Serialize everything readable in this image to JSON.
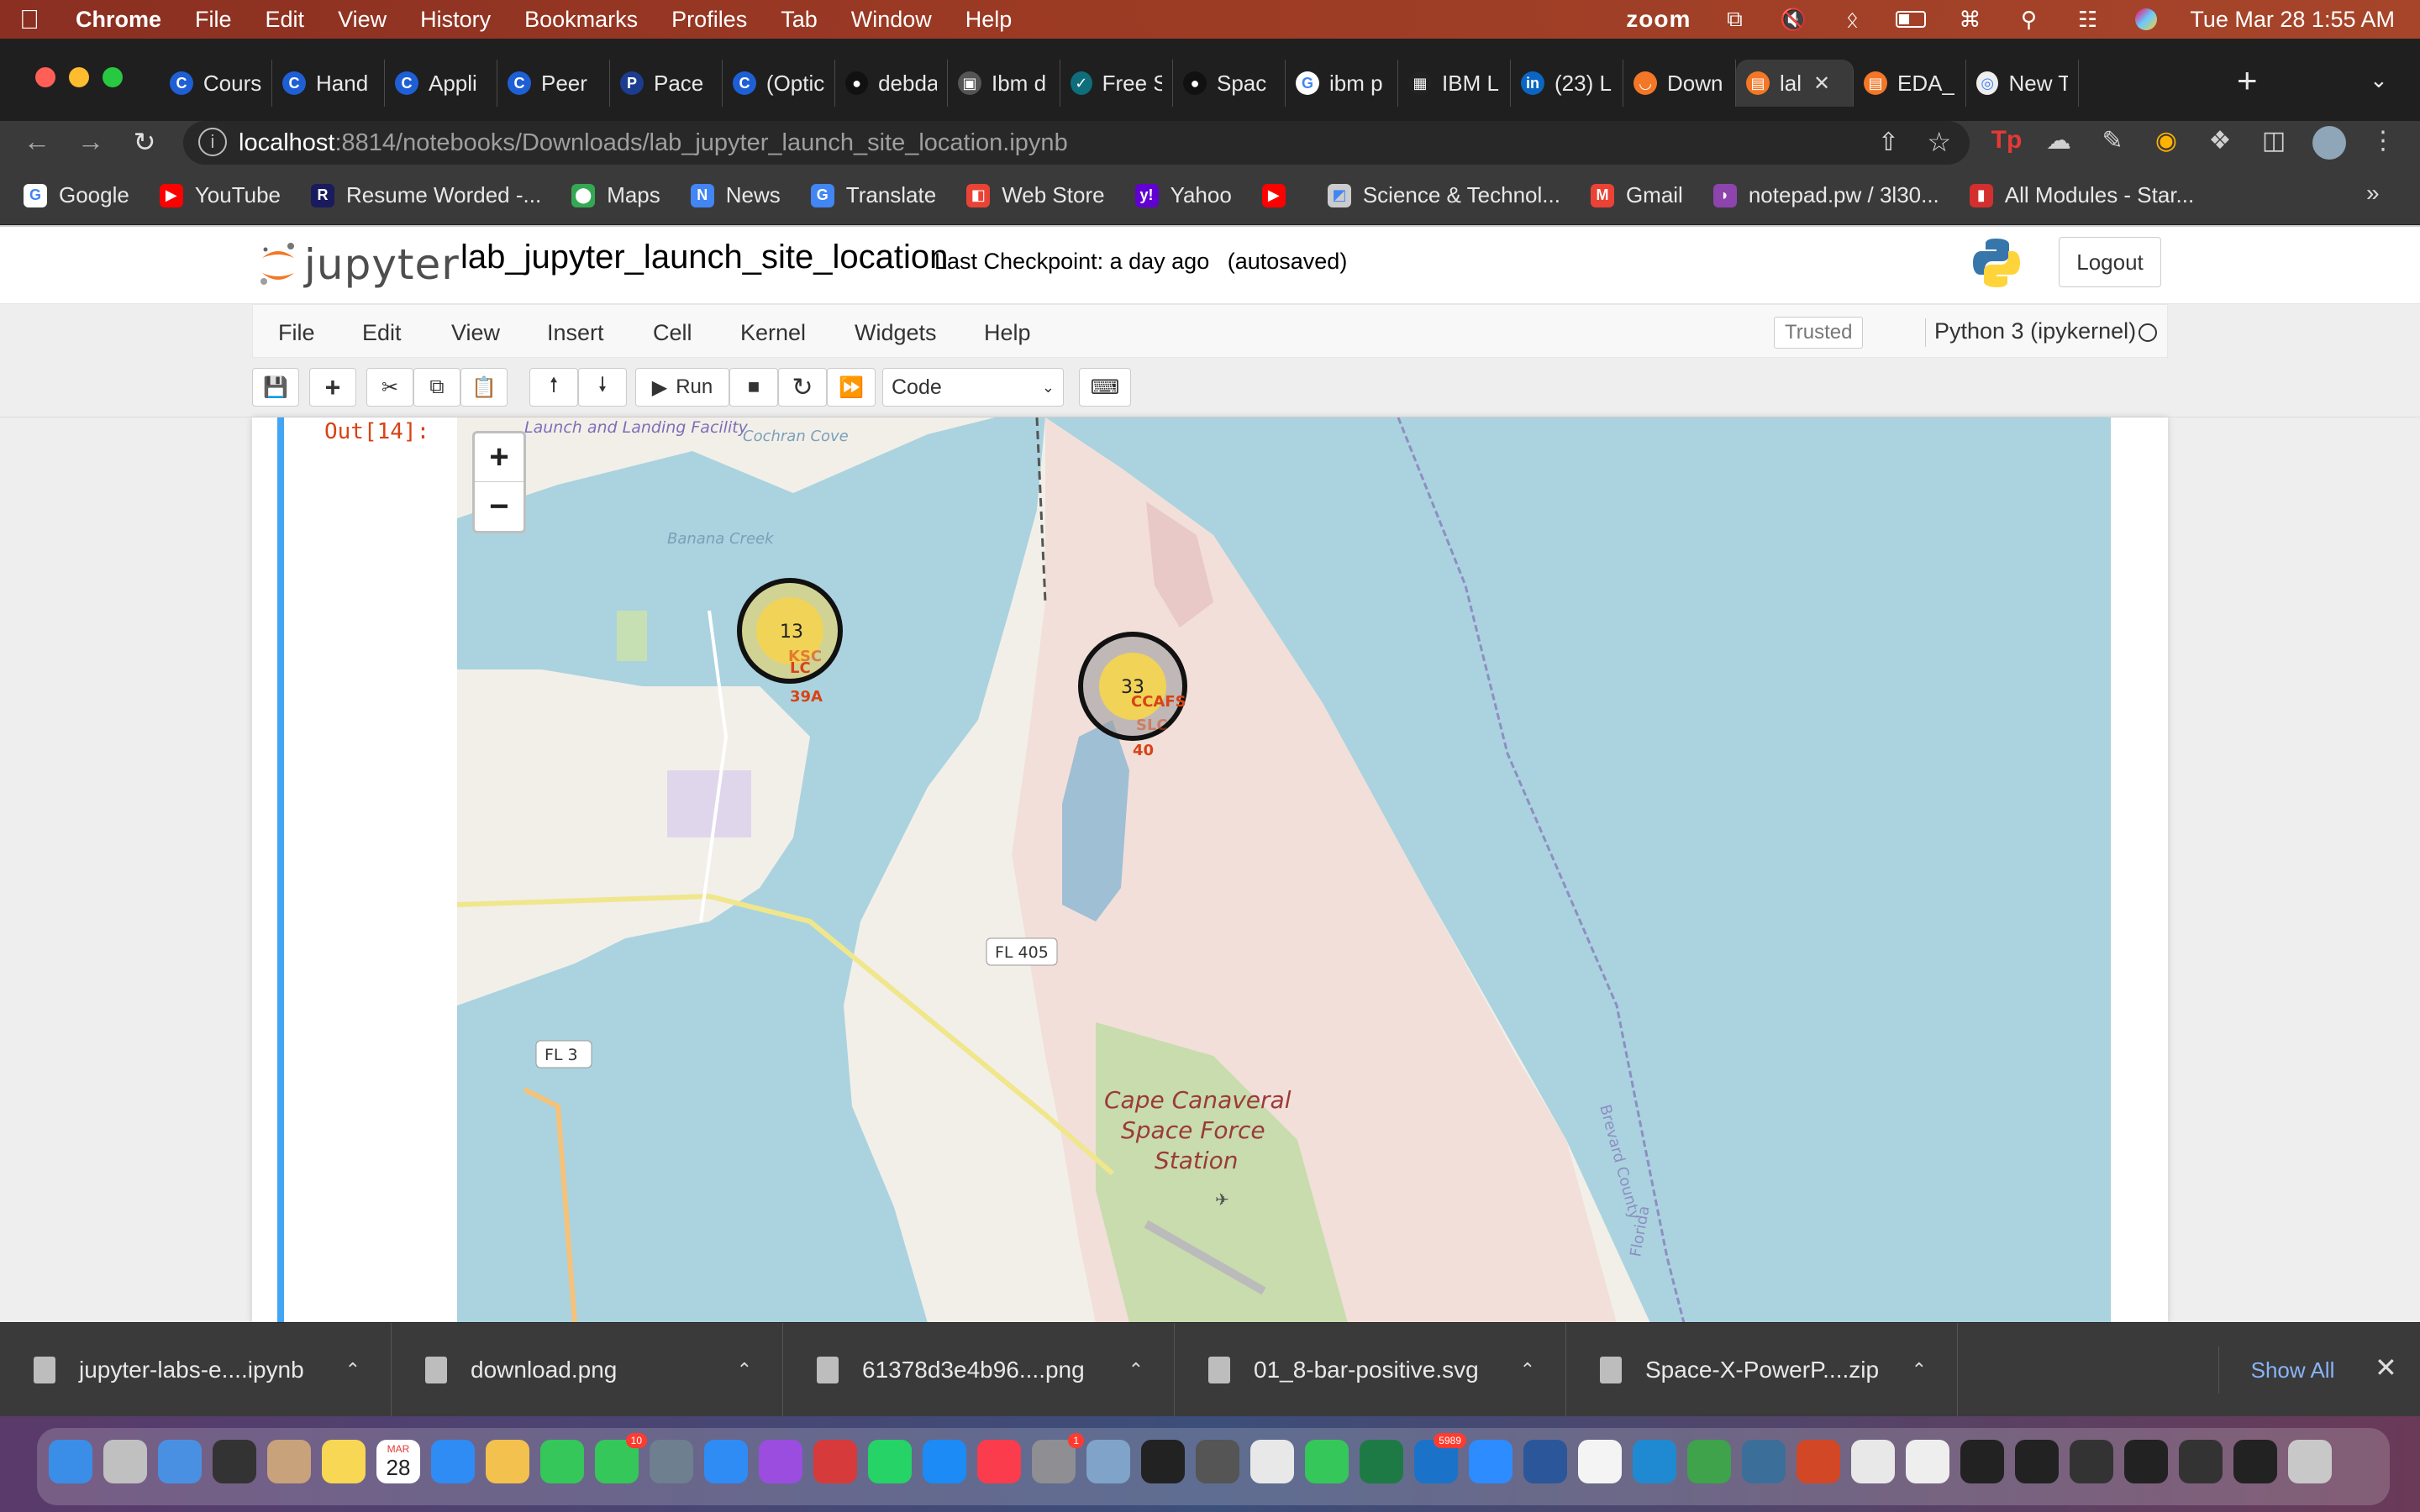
{
  "menubar": {
    "app": "Chrome",
    "items": [
      "File",
      "Edit",
      "View",
      "History",
      "Bookmarks",
      "Profiles",
      "Tab",
      "Window",
      "Help"
    ],
    "zoom_label": "zoom",
    "datetime": "Tue Mar 28  1:55 AM"
  },
  "tabs": [
    {
      "label": "Cours",
      "icon": "coursera-icon",
      "color": "#1f5fd6",
      "glyph": "C"
    },
    {
      "label": "Hand",
      "icon": "coursera-icon",
      "color": "#1f5fd6",
      "glyph": "C"
    },
    {
      "label": "Appli",
      "icon": "coursera-icon",
      "color": "#1f5fd6",
      "glyph": "C"
    },
    {
      "label": "Peer",
      "icon": "coursera-icon",
      "color": "#1f5fd6",
      "glyph": "C"
    },
    {
      "label": "Pace",
      "icon": "pace-icon",
      "color": "#1c3d8f",
      "glyph": "P"
    },
    {
      "label": "(Optic",
      "icon": "coursera-icon",
      "color": "#1f5fd6",
      "glyph": "C"
    },
    {
      "label": "debda",
      "icon": "github-icon",
      "color": "#111111",
      "glyph": "●"
    },
    {
      "label": "Ibm d",
      "icon": "ibm-icon",
      "color": "#555555",
      "glyph": "▣"
    },
    {
      "label": "Free S",
      "icon": "freecodecamp-icon",
      "color": "#0f6e7c",
      "glyph": "✓"
    },
    {
      "label": "Spac",
      "icon": "github-icon",
      "color": "#111111",
      "glyph": "●"
    },
    {
      "label": "ibm p",
      "icon": "google-icon",
      "color": "#ffffff",
      "glyph": "G"
    },
    {
      "label": "IBM L",
      "icon": "ibm-logo-icon",
      "color": "#222222",
      "glyph": "▦"
    },
    {
      "label": "(23) L",
      "icon": "linkedin-icon",
      "color": "#0a66c2",
      "glyph": "in"
    },
    {
      "label": "Down",
      "icon": "jupyter-icon",
      "color": "#f37726",
      "glyph": "◡"
    },
    {
      "label": "lal",
      "icon": "notebook-icon",
      "color": "#f37726",
      "glyph": "▤",
      "active": true
    },
    {
      "label": "EDA_",
      "icon": "notebook-icon",
      "color": "#f37726",
      "glyph": "▤"
    },
    {
      "label": "New T",
      "icon": "chrome-icon",
      "color": "#eeeeee",
      "glyph": "◎"
    }
  ],
  "address": {
    "host": "localhost",
    "path": ":8814/notebooks/Downloads/lab_jupyter_launch_site_location.ipynb"
  },
  "bookmarks": [
    {
      "label": "Google",
      "icon": "google-icon",
      "color": "#ffffff",
      "glyph": "G"
    },
    {
      "label": "YouTube",
      "icon": "youtube-icon",
      "color": "#ff0000",
      "glyph": "▶"
    },
    {
      "label": "Resume Worded -...",
      "icon": "resume-worded-icon",
      "color": "#1a1a5e",
      "glyph": "R"
    },
    {
      "label": "Maps",
      "icon": "maps-icon",
      "color": "#34a853",
      "glyph": "⬤"
    },
    {
      "label": "News",
      "icon": "news-icon",
      "color": "#4285f4",
      "glyph": "N"
    },
    {
      "label": "Translate",
      "icon": "translate-icon",
      "color": "#4285f4",
      "glyph": "G"
    },
    {
      "label": "Web Store",
      "icon": "webstore-icon",
      "color": "#ea4335",
      "glyph": "◧"
    },
    {
      "label": "Yahoo",
      "icon": "yahoo-icon",
      "color": "#6001d2",
      "glyph": "y!"
    },
    {
      "label": "",
      "icon": "youtube-icon",
      "color": "#ff0000",
      "glyph": "▶"
    },
    {
      "label": "Science & Technol...",
      "icon": "science-icon",
      "color": "#cccccc",
      "glyph": "◩"
    },
    {
      "label": "Gmail",
      "icon": "gmail-icon",
      "color": "#ea4335",
      "glyph": "M"
    },
    {
      "label": "notepad.pw / 3l30...",
      "icon": "notepad-icon",
      "color": "#8e44ad",
      "glyph": "◗"
    },
    {
      "label": "All Modules - Star...",
      "icon": "modules-icon",
      "color": "#d32f2f",
      "glyph": "▮"
    }
  ],
  "jupyter": {
    "logo_text": "jupyter",
    "notebook_title": "lab_jupyter_launch_site_location",
    "checkpoint": "Last Checkpoint: a day ago",
    "autosave": "(autosaved)",
    "logout": "Logout",
    "menu": [
      "File",
      "Edit",
      "View",
      "Insert",
      "Cell",
      "Kernel",
      "Widgets",
      "Help"
    ],
    "trusted": "Trusted",
    "kernel": "Python 3 (ipykernel)",
    "run_label": "Run",
    "cell_type": "Code",
    "out_prompt": "Out[14]:"
  },
  "map": {
    "zoom_in": "+",
    "zoom_out": "−",
    "clusters": [
      {
        "count": "13",
        "label_line1": "KSC",
        "label_line2": "LC",
        "label_line3": "39A"
      },
      {
        "count": "33",
        "label_line1": "CCAFS",
        "label_line2": "SLC",
        "label_line3": "40"
      }
    ],
    "place_labels": {
      "launch_facility": "Launch and Landing Facility",
      "cochran_cove": "Cochran Cove",
      "banana_creek": "Banana Creek",
      "station_line1": "Cape Canaveral",
      "station_line2": "Space Force",
      "station_line3": "Station",
      "fl405": "FL 405",
      "fl3": "FL 3",
      "brevard": "Brevard County",
      "florida": "Florida"
    },
    "colors": {
      "water": "#aad3df",
      "land": "#f2efe9",
      "cluster_fill": "#f1d357",
      "cluster_ring": "#111111",
      "marker_text": "#d84315"
    }
  },
  "downloads": [
    {
      "name": "jupyter-labs-e....ipynb",
      "icon": "file-icon"
    },
    {
      "name": "download.png",
      "icon": "file-icon"
    },
    {
      "name": "61378d3e4b96....png",
      "icon": "file-icon"
    },
    {
      "name": "01_8-bar-positive.svg",
      "icon": "chrome-file-icon"
    },
    {
      "name": "Space-X-PowerP....zip",
      "icon": "file-icon"
    }
  ],
  "downloads_show_all": "Show All",
  "dock": {
    "calendar_month": "MAR",
    "calendar_day": "28",
    "badges": {
      "messages": "10",
      "settings": "1",
      "outlook": "5989"
    }
  }
}
